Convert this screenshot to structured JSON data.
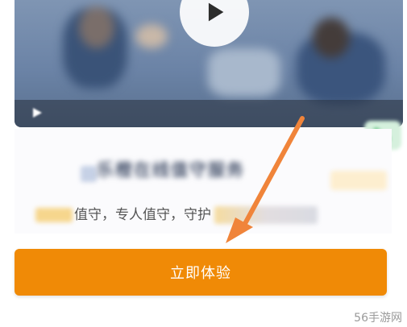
{
  "video": {
    "play_icon": "play-icon",
    "state": "paused"
  },
  "info": {
    "headline": "乐橙在线值守服务",
    "description": "值守，专人值守，守护"
  },
  "cta": {
    "label": "立即体验",
    "color": "#f08a06"
  },
  "annotation": {
    "arrow_color": "#f0843a"
  },
  "watermark": {
    "text": "56手游网"
  }
}
